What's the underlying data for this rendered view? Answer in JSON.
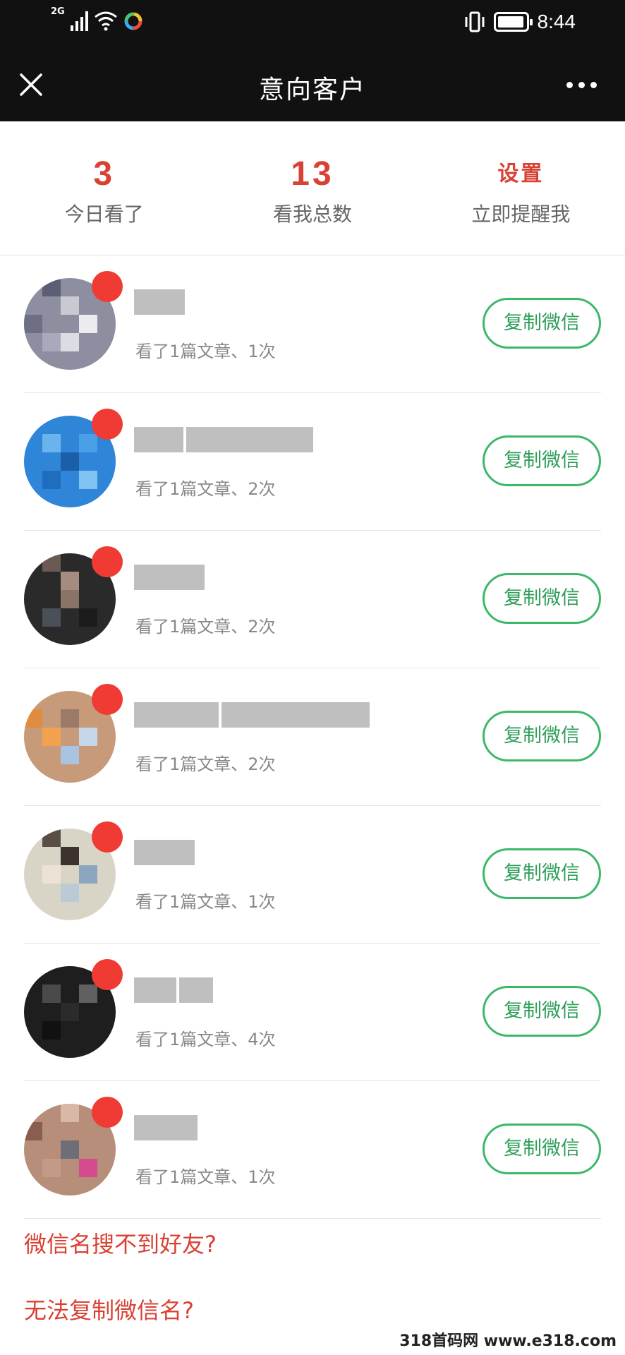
{
  "status_bar": {
    "network": "2G",
    "time": "8:44"
  },
  "header": {
    "title": "意向客户"
  },
  "stats": [
    {
      "value": "3",
      "label": "今日看了"
    },
    {
      "value": "13",
      "label": "看我总数"
    },
    {
      "value": "设置",
      "label": "立即提醒我"
    }
  ],
  "customers": [
    {
      "meta": "看了1篇文章、1次",
      "copy_label": "复制微信"
    },
    {
      "meta": "看了1篇文章、2次",
      "copy_label": "复制微信"
    },
    {
      "meta": "看了1篇文章、2次",
      "copy_label": "复制微信"
    },
    {
      "meta": "看了1篇文章、2次",
      "copy_label": "复制微信"
    },
    {
      "meta": "看了1篇文章、1次",
      "copy_label": "复制微信"
    },
    {
      "meta": "看了1篇文章、4次",
      "copy_label": "复制微信"
    },
    {
      "meta": "看了1篇文章、1次",
      "copy_label": "复制微信"
    }
  ],
  "help": {
    "link1": "微信名搜不到好友?",
    "link2": "无法复制微信名?"
  },
  "watermark": "318首码网 www.e318.com",
  "colors": {
    "accent_red": "#d94133",
    "button_green": "#3db86b",
    "header_bg": "#111111"
  }
}
